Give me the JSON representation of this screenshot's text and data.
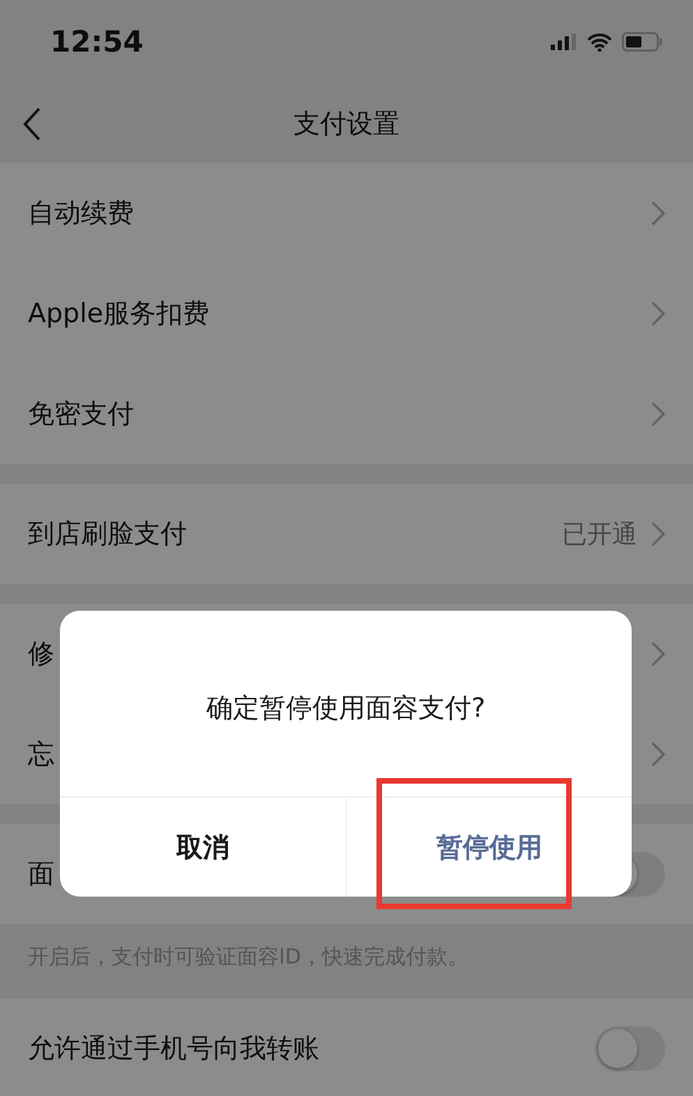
{
  "status_bar": {
    "time": "12:54"
  },
  "nav": {
    "title": "支付设置"
  },
  "sections": [
    {
      "rows": [
        {
          "kind": "link",
          "label": "自动续费"
        },
        {
          "kind": "link",
          "label": "Apple服务扣费"
        },
        {
          "kind": "link",
          "label": "免密支付"
        }
      ]
    },
    {
      "rows": [
        {
          "kind": "link",
          "label": "到店刷脸支付",
          "value": "已开通"
        }
      ]
    },
    {
      "rows": [
        {
          "kind": "link",
          "label": "修"
        },
        {
          "kind": "link",
          "label": "忘"
        }
      ]
    },
    {
      "rows": [
        {
          "kind": "toggle",
          "label": "面",
          "on": false
        }
      ],
      "footnote": "开启后，支付时可验证面容ID，快速完成付款。"
    },
    {
      "rows": [
        {
          "kind": "toggle",
          "label": "允许通过手机号向我转账",
          "on": false
        }
      ]
    }
  ],
  "dialog": {
    "message": "确定暂停使用面容支付?",
    "buttons": [
      {
        "kind": "cancel",
        "label": "取消",
        "highlighted": false
      },
      {
        "kind": "confirm",
        "label": "暂停使用",
        "highlighted": true
      }
    ]
  }
}
